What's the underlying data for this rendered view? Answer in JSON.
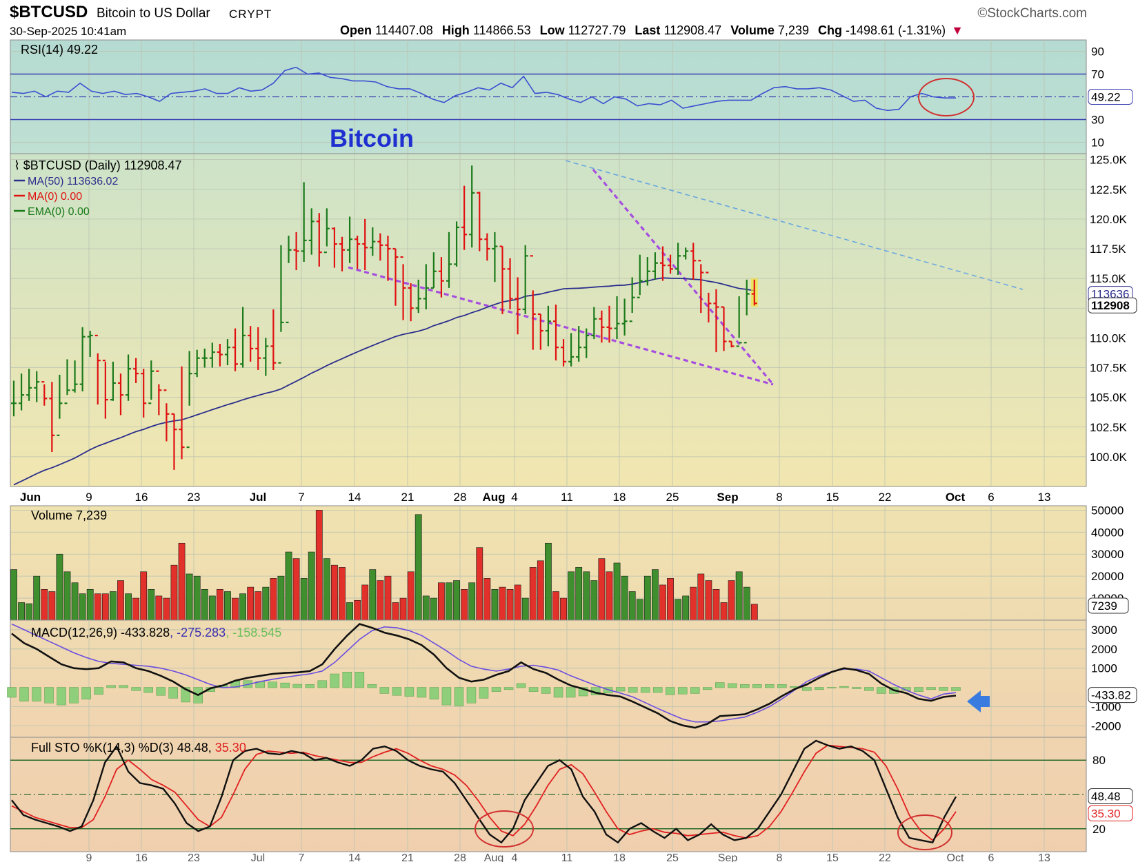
{
  "header": {
    "symbol": "$BTCUSD",
    "name": "Bitcoin to US Dollar",
    "type": "CRYPT",
    "datetime": "30-Sep-2025 10:41am",
    "logo": "©StockCharts.com",
    "open_label": "Open",
    "open": "114407.08",
    "high_label": "High",
    "high": "114866.53",
    "low_label": "Low",
    "low": "112727.79",
    "last_label": "Last",
    "last": "112908.47",
    "volume_label": "Volume",
    "volume": "7,239",
    "chg_label": "Chg",
    "chg": "-1498.61 (-1.31%)",
    "chg_icon": "down-triangle-icon"
  },
  "colors": {
    "up": "#1a7a1a",
    "down": "#e01010",
    "ma50": "#2b2e8c",
    "rsi": "#3a4fd0",
    "trend": "#a64de0",
    "resistance": "#6aa6e0",
    "macd": "#111111",
    "signal": "#6a4de0",
    "hist": "#8fce7a",
    "stok": "#111111",
    "stod": "#e02020",
    "annot": "#d03030",
    "arrow": "#3a7be0"
  },
  "chart_data": [
    {
      "type": "line",
      "panel": "rsi",
      "title": "RSI(14) 49.22",
      "y_ticks": [
        90,
        70,
        30,
        10
      ],
      "reference_lines": [
        70,
        50,
        30
      ],
      "ylim": [
        0,
        100
      ],
      "last_label": "49.22",
      "x_index_range": [
        0,
        83
      ],
      "series": [
        {
          "name": "RSI(14)",
          "values": [
            54,
            53,
            55,
            50,
            55,
            54,
            62,
            55,
            53,
            55,
            52,
            53,
            50,
            46,
            53,
            54,
            55,
            57,
            53,
            53,
            58,
            55,
            56,
            62,
            73,
            76,
            70,
            71,
            67,
            66,
            64,
            64,
            63,
            59,
            57,
            57,
            53,
            48,
            45,
            51,
            54,
            58,
            56,
            62,
            58,
            68,
            53,
            54,
            52,
            48,
            45,
            50,
            44,
            50,
            48,
            42,
            44,
            43,
            47,
            40,
            42,
            44,
            46,
            47,
            47,
            47,
            53,
            58,
            59,
            57,
            57,
            58,
            56,
            51,
            46,
            47,
            40,
            38,
            39,
            50,
            53,
            50,
            49,
            49
          ]
        }
      ]
    },
    {
      "type": "ohlc",
      "panel": "price",
      "title": "$BTCUSD (Daily) 112908.47",
      "legend": [
        {
          "name": "MA(50) 113636.02",
          "color": "#2b2e8c"
        },
        {
          "name": "MA(0) 0.00",
          "color": "#e01010"
        },
        {
          "name": "EMA(0) 0.00",
          "color": "#1a7a1a"
        }
      ],
      "annotation": "Bitcoin",
      "x_tick_labels": [
        "Jun",
        "9",
        "16",
        "23",
        "Jul",
        "7",
        "14",
        "21",
        "28",
        "Aug",
        "4",
        "11",
        "18",
        "25",
        "Sep",
        "8",
        "15",
        "22",
        "Oct",
        "6",
        "13"
      ],
      "y_tick_labels": [
        "125.0K",
        "122.5K",
        "120.0K",
        "117.5K",
        "115.0K",
        "112.5K",
        "110.0K",
        "107.5K",
        "105.0K",
        "102.5K",
        "100.0K"
      ],
      "y_ticks": [
        125000,
        122500,
        120000,
        117500,
        115000,
        112500,
        110000,
        107500,
        105000,
        102500,
        100000
      ],
      "ylim": [
        97500,
        125500
      ],
      "last_label": "112908",
      "ma_label": "113636",
      "close": [
        104500,
        105200,
        105800,
        106300,
        104900,
        101800,
        104500,
        105600,
        106100,
        110100,
        110200,
        108100,
        104800,
        106200,
        105200,
        107400,
        107000,
        104500,
        107200,
        105600,
        103600,
        102300,
        100800,
        107000,
        108300,
        108300,
        108800,
        108600,
        109200,
        107800,
        110200,
        109100,
        108300,
        109300,
        107900,
        111300,
        117400,
        117300,
        118200,
        119800,
        117200,
        119200,
        117900,
        117400,
        118300,
        117900,
        117600,
        118100,
        117800,
        117500,
        116800,
        114200,
        112500,
        113300,
        114200,
        115600,
        114800,
        116200,
        119300,
        118700,
        122200,
        118300,
        117500,
        117700,
        115800,
        113300,
        112400,
        116900,
        112000,
        110600,
        111400,
        109200,
        108000,
        108400,
        109200,
        110200,
        111600,
        110900,
        110800,
        111200,
        111400,
        113400,
        114800,
        115600,
        116300,
        116100,
        115800,
        116900,
        117300,
        116500,
        115500,
        112900,
        112600,
        109700,
        109300,
        109600,
        113700,
        112908
      ],
      "high": [
        106400,
        107000,
        107400,
        107200,
        106100,
        106300,
        106900,
        108200,
        108100,
        110900,
        110600,
        108700,
        108000,
        108000,
        107000,
        108600,
        108300,
        107400,
        108100,
        106100,
        104500,
        103600,
        107600,
        108900,
        109000,
        109100,
        109600,
        109500,
        109900,
        110800,
        112600,
        111000,
        110900,
        110000,
        112400,
        117800,
        118600,
        118900,
        123100,
        120900,
        120500,
        120900,
        119300,
        118500,
        120200,
        118600,
        120000,
        119300,
        118800,
        118600,
        117500,
        116200,
        114600,
        114900,
        116200,
        117200,
        116800,
        118900,
        119800,
        122800,
        124500,
        122300,
        118800,
        118900,
        117700,
        116700,
        115100,
        117800,
        114000,
        112000,
        112700,
        112800,
        109900,
        110400,
        111000,
        110800,
        112600,
        112300,
        112700,
        113500,
        113300,
        115100,
        117000,
        116800,
        117200,
        117700,
        117000,
        118000,
        117600,
        118000,
        116200,
        113800,
        114100,
        112600,
        109700,
        113500,
        114900,
        114900
      ],
      "low": [
        103400,
        103900,
        104700,
        104600,
        104300,
        100400,
        103200,
        105200,
        105400,
        105500,
        108400,
        104400,
        103200,
        104700,
        103500,
        104700,
        106200,
        103300,
        104800,
        103500,
        101300,
        98900,
        99800,
        104300,
        106700,
        107500,
        107500,
        107600,
        107700,
        107200,
        107500,
        108000,
        107300,
        106800,
        107300,
        110500,
        116300,
        115700,
        116400,
        117000,
        116000,
        117700,
        115900,
        115600,
        116300,
        115800,
        115700,
        116900,
        116500,
        114800,
        112700,
        111500,
        111400,
        112100,
        112400,
        114200,
        113400,
        114200,
        116000,
        117400,
        117600,
        117300,
        116500,
        114700,
        112000,
        112400,
        110300,
        112000,
        109000,
        109000,
        109300,
        108100,
        107600,
        107600,
        108000,
        108300,
        109900,
        109600,
        109600,
        109900,
        110200,
        112100,
        113600,
        114400,
        114900,
        114800,
        115400,
        115300,
        116600,
        114900,
        112100,
        111300,
        108800,
        108900,
        109200,
        110000,
        111900,
        112728
      ]
    },
    {
      "type": "bar",
      "panel": "volume",
      "title": "Volume 7,239",
      "y_ticks": [
        50000,
        40000,
        30000,
        20000,
        10000
      ],
      "ylim": [
        0,
        52000
      ],
      "last_label": "7239",
      "values": [
        23000,
        8000,
        7500,
        20000,
        14000,
        13000,
        30000,
        22000,
        17000,
        12000,
        14000,
        12000,
        12000,
        13000,
        18000,
        12000,
        10000,
        22000,
        14000,
        11000,
        10000,
        25000,
        35000,
        21000,
        20000,
        14000,
        11000,
        14000,
        13000,
        10000,
        12000,
        15000,
        13000,
        15000,
        19000,
        20000,
        31000,
        28000,
        19000,
        31000,
        50000,
        28000,
        25000,
        24000,
        8000,
        9000,
        16000,
        23000,
        18000,
        20000,
        8000,
        10000,
        22000,
        48000,
        11000,
        10000,
        17000,
        17000,
        18000,
        14000,
        17000,
        33000,
        19000,
        14000,
        15000,
        14000,
        16000,
        10000,
        24000,
        27000,
        35000,
        13000,
        10000,
        22000,
        24000,
        22000,
        18000,
        28000,
        22000,
        26000,
        20000,
        13000,
        9500,
        20000,
        23000,
        16000,
        19000,
        9500,
        11000,
        15000,
        21000,
        18000,
        14000,
        8000,
        18000,
        22000,
        15000,
        7239
      ]
    },
    {
      "type": "line",
      "panel": "macd",
      "title": "MACD(12,26,9) -433.828",
      "signal_label": "-275.283",
      "hist_label": "-158.545",
      "y_ticks": [
        3000,
        2000,
        1000,
        -1000,
        -2000
      ],
      "ylim": [
        -2600,
        3500
      ],
      "last_label": "-433.82",
      "x_index_range": [
        0,
        83
      ],
      "series": [
        {
          "name": "MACD",
          "values": [
            2800,
            2300,
            2000,
            1600,
            1200,
            1000,
            950,
            1000,
            1350,
            1300,
            1000,
            850,
            600,
            300,
            -100,
            -400,
            -50,
            100,
            350,
            500,
            600,
            700,
            750,
            780,
            850,
            1200,
            2000,
            2700,
            3300,
            3100,
            2850,
            2700,
            2500,
            2200,
            1700,
            1000,
            500,
            300,
            400,
            650,
            850,
            1300,
            950,
            750,
            400,
            100,
            -80,
            -280,
            -400,
            -480,
            -750,
            -1050,
            -1350,
            -1750,
            -1980,
            -2100,
            -1900,
            -1500,
            -1450,
            -1400,
            -1150,
            -850,
            -450,
            -100,
            150,
            500,
            800,
            1000,
            900,
            700,
            200,
            -150,
            -300,
            -600,
            -700,
            -500,
            -430
          ]
        },
        {
          "name": "Signal",
          "values": [
            3300,
            3000,
            2700,
            2400,
            2100,
            1800,
            1550,
            1350,
            1250,
            1200,
            1150,
            1100,
            1000,
            850,
            650,
            400,
            150,
            -20,
            20,
            150,
            300,
            420,
            520,
            620,
            700,
            850,
            1300,
            1900,
            2500,
            2950,
            3150,
            3100,
            2950,
            2700,
            2300,
            1900,
            1450,
            1100,
            950,
            850,
            950,
            1100,
            1150,
            1050,
            900,
            600,
            350,
            100,
            -120,
            -300,
            -500,
            -800,
            -1100,
            -1380,
            -1650,
            -1800,
            -1800,
            -1750,
            -1650,
            -1550,
            -1300,
            -1000,
            -600,
            -150,
            300,
            600,
            820,
            950,
            950,
            850,
            500,
            150,
            -150,
            -400,
            -600,
            -350,
            -275
          ]
        }
      ],
      "histogram": [
        -500,
        -700,
        -700,
        -800,
        -900,
        -800,
        -600,
        -350,
        100,
        100,
        -150,
        -250,
        -400,
        -550,
        -750,
        -800,
        -200,
        120,
        330,
        350,
        300,
        280,
        230,
        160,
        150,
        350,
        700,
        800,
        800,
        150,
        -300,
        -400,
        -450,
        -500,
        -600,
        -900,
        -950,
        -800,
        -550,
        -200,
        -100,
        200,
        -200,
        -300,
        -500,
        -500,
        -430,
        -380,
        -280,
        -180,
        -250,
        -250,
        -250,
        -370,
        -330,
        -300,
        -100,
        250,
        200,
        150,
        150,
        150,
        150,
        50,
        -150,
        -100,
        -20,
        50,
        -50,
        -150,
        -300,
        -300,
        -150,
        -200,
        -100,
        -150,
        -158
      ]
    },
    {
      "type": "line",
      "panel": "stochastic",
      "title": "Full STO %K(14,3) %D(3) 48.48,",
      "d_label": "35.30",
      "y_ticks": [
        80,
        20
      ],
      "reference_lines": [
        80,
        50,
        20
      ],
      "ylim": [
        0,
        100
      ],
      "last_labels": [
        "48.48",
        "35.30"
      ],
      "x_index_range": [
        0,
        83
      ],
      "series": [
        {
          "name": "%K",
          "values": [
            45,
            32,
            28,
            25,
            22,
            18,
            22,
            45,
            78,
            92,
            70,
            60,
            58,
            55,
            42,
            25,
            18,
            22,
            48,
            80,
            88,
            90,
            86,
            85,
            88,
            86,
            80,
            82,
            78,
            75,
            80,
            90,
            92,
            88,
            80,
            75,
            72,
            70,
            60,
            45,
            30,
            15,
            8,
            20,
            45,
            60,
            75,
            80,
            72,
            48,
            35,
            15,
            8,
            20,
            25,
            18,
            12,
            20,
            10,
            15,
            24,
            15,
            10,
            12,
            20,
            35,
            50,
            70,
            90,
            97,
            93,
            90,
            92,
            88,
            80,
            55,
            30,
            12,
            10,
            8,
            30,
            48
          ]
        },
        {
          "name": "%D",
          "values": [
            40,
            35,
            30,
            27,
            24,
            21,
            21,
            28,
            48,
            72,
            80,
            72,
            63,
            58,
            52,
            40,
            28,
            22,
            30,
            50,
            72,
            85,
            88,
            87,
            86,
            87,
            84,
            82,
            80,
            78,
            78,
            83,
            87,
            90,
            86,
            80,
            75,
            72,
            67,
            58,
            45,
            30,
            18,
            14,
            24,
            40,
            58,
            72,
            76,
            68,
            52,
            35,
            20,
            15,
            18,
            20,
            17,
            16,
            14,
            15,
            16,
            17,
            14,
            12,
            14,
            22,
            35,
            52,
            70,
            86,
            93,
            92,
            91,
            90,
            87,
            75,
            55,
            32,
            18,
            10,
            20,
            35
          ]
        }
      ]
    }
  ]
}
